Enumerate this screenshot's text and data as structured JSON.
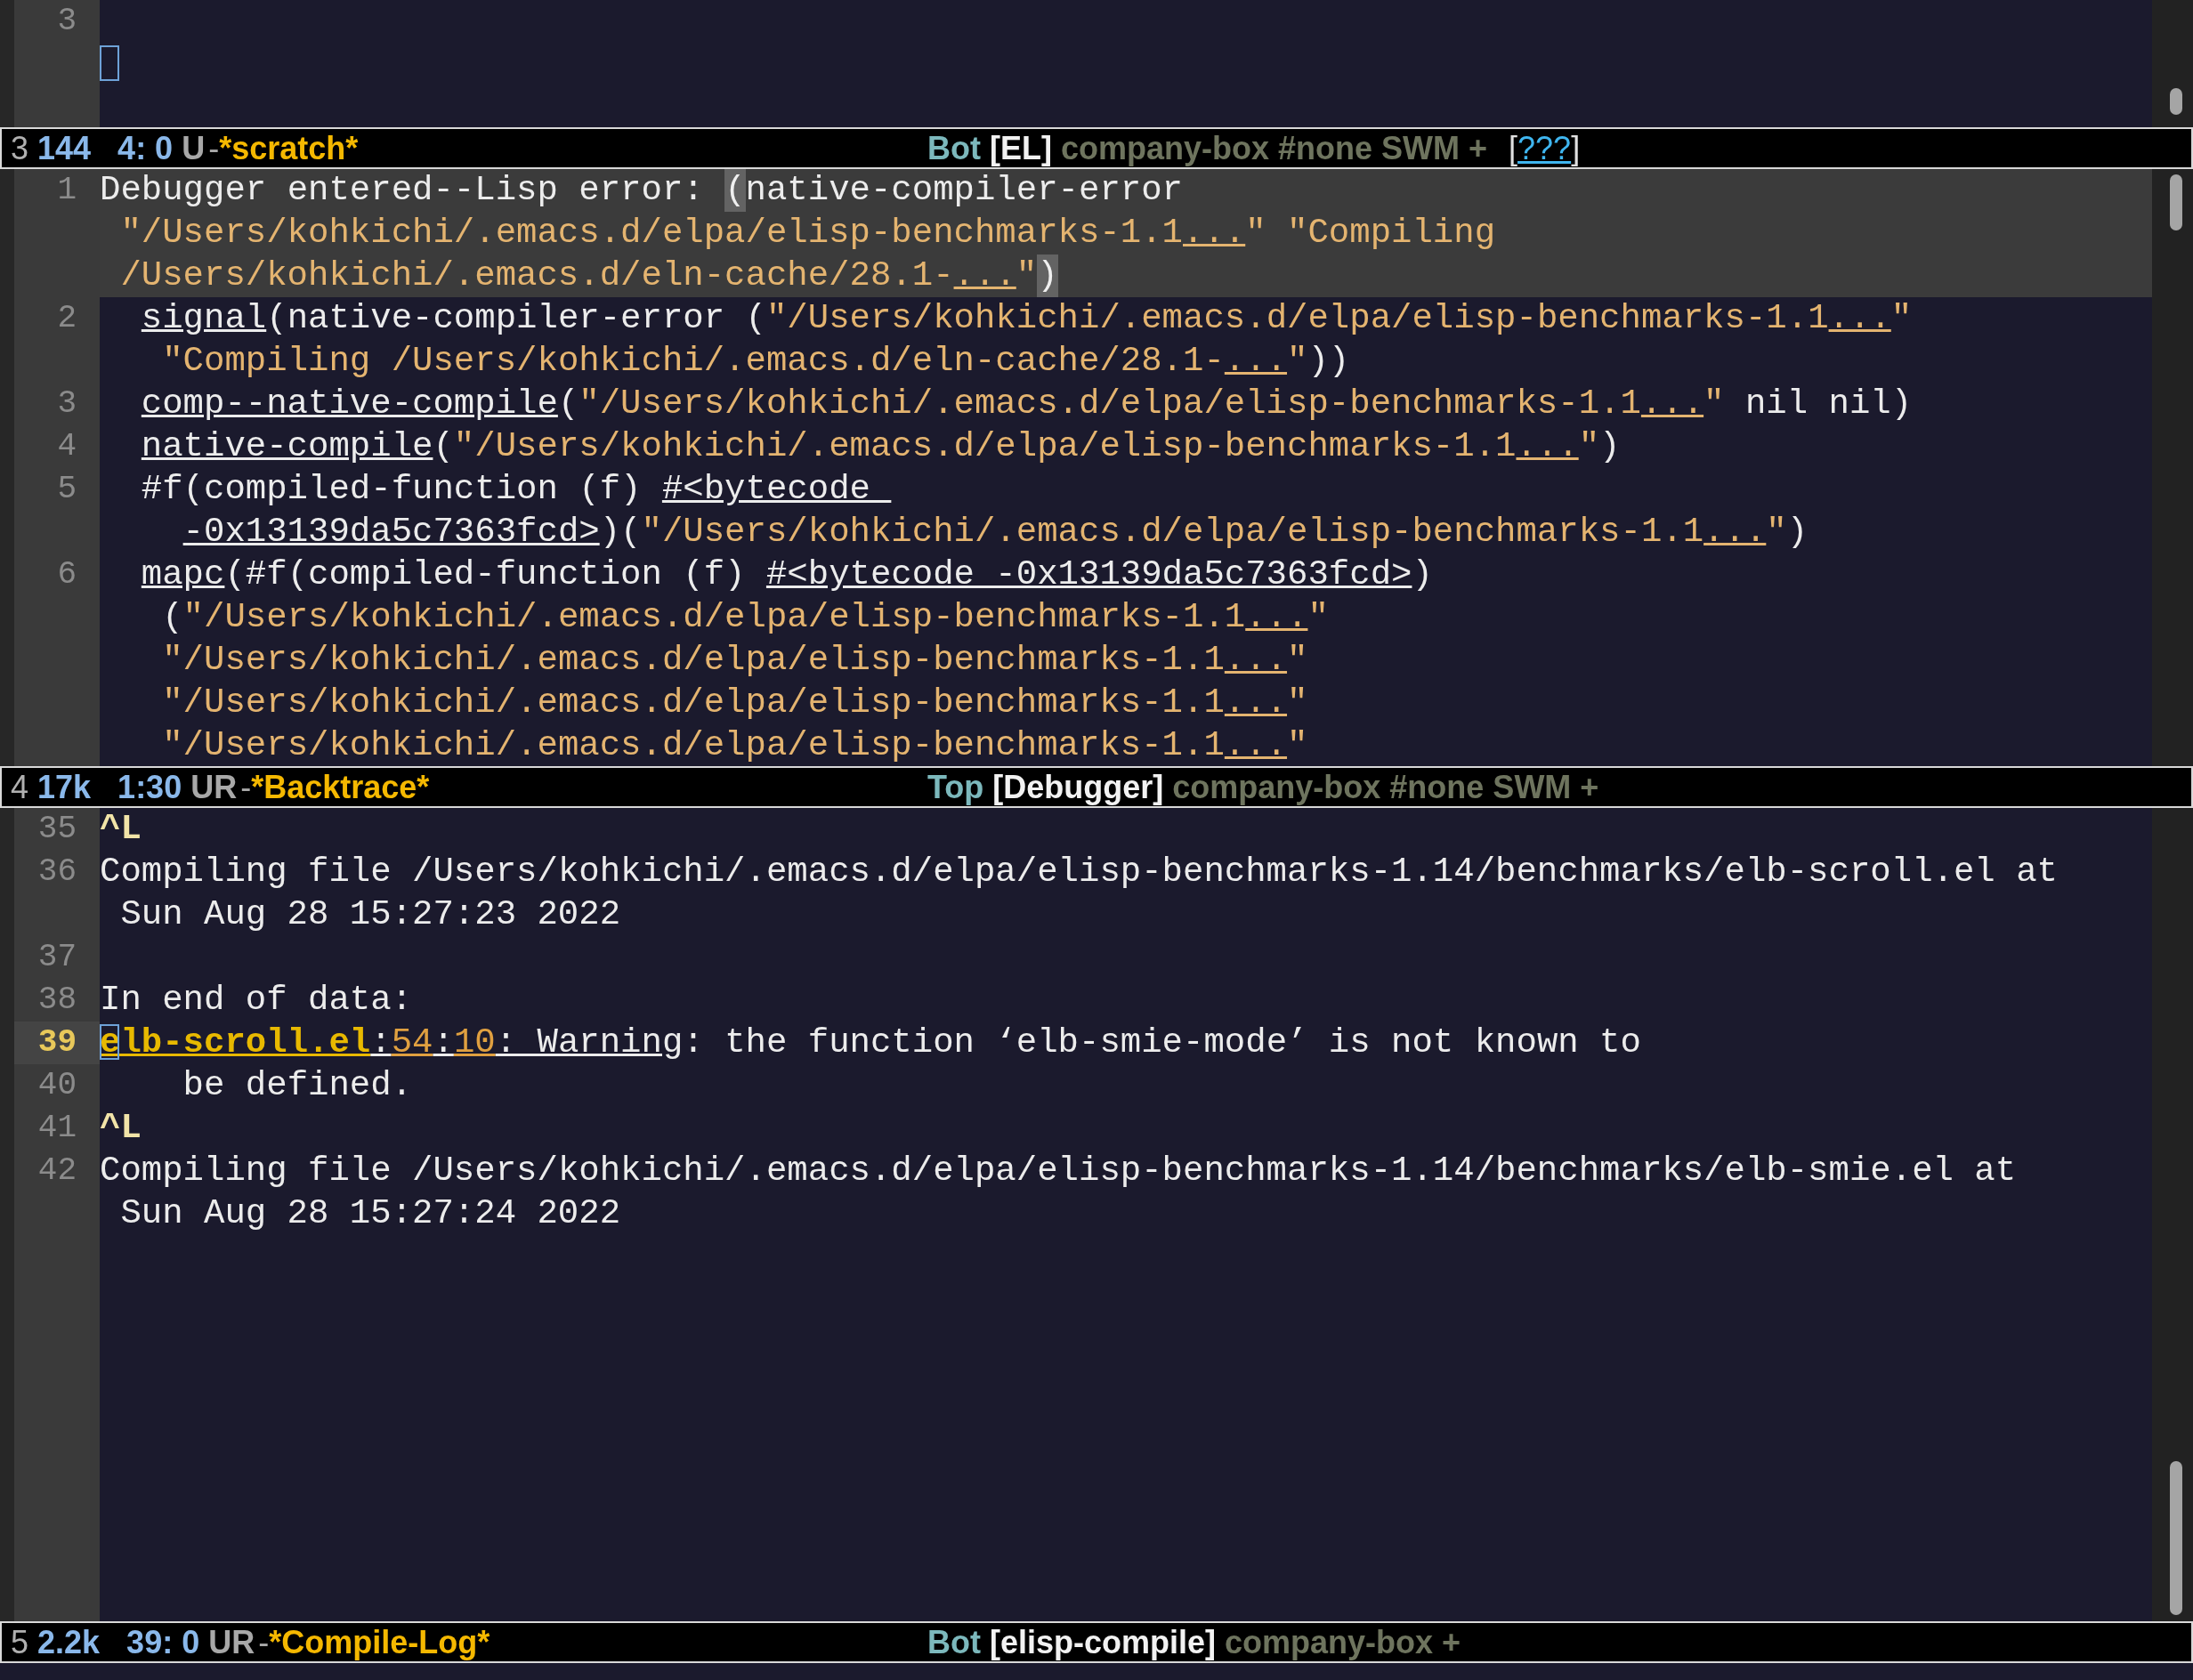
{
  "panes": [
    {
      "lines": [
        {
          "number": "3"
        },
        {
          "cursor": true
        }
      ],
      "mode_line": {
        "left": [
          {
            "text": "3",
            "kind": "window"
          },
          {
            "text": "144",
            "kind": "size"
          },
          {
            "text": "4: 0",
            "kind": "position"
          },
          {
            "text": "U",
            "kind": "flags"
          },
          {
            "text": "-",
            "kind": "dash"
          },
          {
            "text": "*scratch*",
            "kind": "buffer"
          }
        ],
        "right": [
          {
            "text": "Bot",
            "kind": "scroll"
          },
          {
            "text": "[EL]",
            "kind": "major"
          },
          {
            "text": "company-box #none SWM +",
            "kind": "minor"
          },
          {
            "text": "[",
            "kind": "bracket"
          },
          {
            "text": "???",
            "kind": "unknown"
          },
          {
            "text": "]",
            "kind": "bracket"
          }
        ]
      }
    },
    {
      "lines": [
        {
          "number": "1",
          "highlighted": true,
          "segments": [
            {
              "text": "Debugger entered--Lisp error: ",
              "kind": "text"
            },
            {
              "text": "(",
              "kind": "paren"
            },
            {
              "text": "native-compiler-error",
              "kind": "text"
            }
          ]
        },
        {
          "highlighted": true,
          "segments": [
            {
              "text": "\"/Users/kohkichi/.emacs.d/elpa/elisp-benchmarks-1.1",
              "kind": "string"
            },
            {
              "text": "...",
              "kind": "ellipsis"
            },
            {
              "text": "\" \"Compiling",
              "kind": "string"
            }
          ]
        },
        {
          "highlighted": true,
          "segments": [
            {
              "text": "/Users/kohkichi/.emacs.d/eln-cache/28.1-",
              "kind": "string"
            },
            {
              "text": "...",
              "kind": "ellipsis"
            },
            {
              "text": "\"",
              "kind": "string"
            },
            {
              "text": ")",
              "kind": "paren"
            }
          ]
        },
        {
          "number": "2",
          "highlighted": false,
          "segments": [
            {
              "text": "signal",
              "kind": "func"
            },
            {
              "text": "(native-compiler-error (",
              "kind": "text"
            },
            {
              "text": "\"/Users/kohkichi/.emacs.d/elpa/elisp-benchmarks-1.1",
              "kind": "string"
            },
            {
              "text": "...",
              "kind": "ellipsis"
            },
            {
              "text": "\"",
              "kind": "string"
            }
          ]
        },
        {
          "highlighted": false,
          "segments": [
            {
              "text": "\"Compiling /Users/kohkichi/.emacs.d/eln-cache/28.1-",
              "kind": "string"
            },
            {
              "text": "...",
              "kind": "ellipsis"
            },
            {
              "text": "\"",
              "kind": "string"
            },
            {
              "text": "))",
              "kind": "text"
            }
          ]
        },
        {
          "number": "3",
          "highlighted": false,
          "segments": [
            {
              "text": "comp--native-compile",
              "kind": "func"
            },
            {
              "text": "(",
              "kind": "text"
            },
            {
              "text": "\"/Users/kohkichi/.emacs.d/elpa/elisp-benchmarks-1.1",
              "kind": "string"
            },
            {
              "text": "...",
              "kind": "ellipsis"
            },
            {
              "text": "\"",
              "kind": "string"
            },
            {
              "text": " nil nil)",
              "kind": "text"
            }
          ]
        },
        {
          "number": "4",
          "highlighted": false,
          "segments": [
            {
              "text": "native-compile",
              "kind": "func"
            },
            {
              "text": "(",
              "kind": "text"
            },
            {
              "text": "\"/Users/kohkichi/.emacs.d/elpa/elisp-benchmarks-1.1",
              "kind": "string"
            },
            {
              "text": "...",
              "kind": "ellipsis"
            },
            {
              "text": "\"",
              "kind": "string"
            },
            {
              "text": ")",
              "kind": "text"
            }
          ]
        },
        {
          "number": "5",
          "highlighted": false,
          "segments": [
            {
              "text": "#f(compiled-function (f) ",
              "kind": "text"
            },
            {
              "text": "#<bytecode ",
              "kind": "func"
            }
          ]
        },
        {
          "highlighted": false,
          "segments": [
            {
              "text": "-0x13139da5c7363fcd>",
              "kind": "func"
            },
            {
              "text": ")(",
              "kind": "text"
            },
            {
              "text": "\"/Users/kohkichi/.emacs.d/elpa/elisp-benchmarks-1.1",
              "kind": "string"
            },
            {
              "text": "...",
              "kind": "ellipsis"
            },
            {
              "text": "\"",
              "kind": "string"
            },
            {
              "text": ")",
              "kind": "text"
            }
          ]
        },
        {
          "number": "6",
          "highlighted": false,
          "segments": [
            {
              "text": "mapc",
              "kind": "func"
            },
            {
              "text": "(#f(compiled-function (f) ",
              "kind": "text"
            },
            {
              "text": "#<bytecode -0x13139da5c7363fcd>",
              "kind": "func"
            },
            {
              "text": ")",
              "kind": "text"
            }
          ]
        },
        {
          "highlighted": false,
          "segments": [
            {
              "text": "(",
              "kind": "text"
            },
            {
              "text": "\"/Users/kohkichi/.emacs.d/elpa/elisp-benchmarks-1.1",
              "kind": "string"
            },
            {
              "text": "...",
              "kind": "ellipsis"
            },
            {
              "text": "\"",
              "kind": "string"
            }
          ]
        },
        {
          "highlighted": false,
          "segments": [
            {
              "text": "\"/Users/kohkichi/.emacs.d/elpa/elisp-benchmarks-1.1",
              "kind": "string"
            },
            {
              "text": "...",
              "kind": "ellipsis"
            },
            {
              "text": "\"",
              "kind": "string"
            }
          ]
        },
        {
          "highlighted": false,
          "segments": [
            {
              "text": "\"/Users/kohkichi/.emacs.d/elpa/elisp-benchmarks-1.1",
              "kind": "string"
            },
            {
              "text": "...",
              "kind": "ellipsis"
            },
            {
              "text": "\"",
              "kind": "string"
            }
          ]
        },
        {
          "highlighted": false,
          "segments": [
            {
              "text": "\"/Users/kohkichi/.emacs.d/elpa/elisp-benchmarks-1.1",
              "kind": "string"
            },
            {
              "text": "...",
              "kind": "ellipsis"
            },
            {
              "text": "\"",
              "kind": "string"
            }
          ]
        }
      ],
      "mode_line": {
        "left": [
          {
            "text": "4",
            "kind": "window"
          },
          {
            "text": "17k",
            "kind": "size"
          },
          {
            "text": "1:30",
            "kind": "position"
          },
          {
            "text": "UR",
            "kind": "flags"
          },
          {
            "text": "-",
            "kind": "dash"
          },
          {
            "text": "*Backtrace*",
            "kind": "buffer"
          }
        ],
        "right": [
          {
            "text": "Top",
            "kind": "scroll"
          },
          {
            "text": "[Debugger]",
            "kind": "major"
          },
          {
            "text": "company-box #none SWM +",
            "kind": "minor"
          }
        ]
      }
    },
    {
      "lines": [
        {
          "number": "35",
          "current": false,
          "segments": [
            {
              "text": "^L",
              "kind": "pagebreak"
            }
          ]
        },
        {
          "number": "36",
          "current": false,
          "segments": [
            {
              "text": "Compiling file /Users/kohkichi/.emacs.d/elpa/elisp-benchmarks-1.14/benchmarks/elb-scroll.el at",
              "kind": "text"
            }
          ]
        },
        {
          "segments": [
            {
              "text": "Sun Aug 28 15:27:23 2022",
              "kind": "text"
            }
          ]
        },
        {
          "number": "37",
          "current": false
        },
        {
          "number": "38",
          "current": false,
          "segments": [
            {
              "text": "In end of data:",
              "kind": "text"
            }
          ]
        },
        {
          "number": "39",
          "current": true,
          "cursor": true,
          "segments": [
            {
              "text": "elb-scroll.el",
              "kind": "file"
            },
            {
              "text": ":",
              "kind": "link"
            },
            {
              "text": "54",
              "kind": "loc"
            },
            {
              "text": ":",
              "kind": "link"
            },
            {
              "text": "10",
              "kind": "loc"
            },
            {
              "text": ": Warning",
              "kind": "link"
            },
            {
              "text": ": the function ‘elb-smie-mode’ is not known to",
              "kind": "text"
            }
          ]
        },
        {
          "number": "40",
          "current": false,
          "segments": [
            {
              "text": "be defined.",
              "kind": "text"
            }
          ]
        },
        {
          "number": "41",
          "current": false,
          "segments": [
            {
              "text": "^L",
              "kind": "pagebreak"
            }
          ]
        },
        {
          "number": "42",
          "current": false,
          "segments": [
            {
              "text": "Compiling file /Users/kohkichi/.emacs.d/elpa/elisp-benchmarks-1.14/benchmarks/elb-smie.el at",
              "kind": "text"
            }
          ]
        },
        {
          "segments": [
            {
              "text": "Sun Aug 28 15:27:24 2022",
              "kind": "text"
            }
          ]
        }
      ],
      "mode_line": {
        "left": [
          {
            "text": "5",
            "kind": "window"
          },
          {
            "text": "2.2k",
            "kind": "size"
          },
          {
            "text": "39: 0",
            "kind": "position"
          },
          {
            "text": "UR",
            "kind": "flags"
          },
          {
            "text": "-",
            "kind": "dash"
          },
          {
            "text": "*Compile-Log*",
            "kind": "buffer"
          }
        ],
        "right": [
          {
            "text": "Bot",
            "kind": "scroll"
          },
          {
            "text": "[elisp-compile]",
            "kind": "major"
          },
          {
            "text": "company-box +",
            "kind": "minor"
          }
        ]
      }
    }
  ]
}
